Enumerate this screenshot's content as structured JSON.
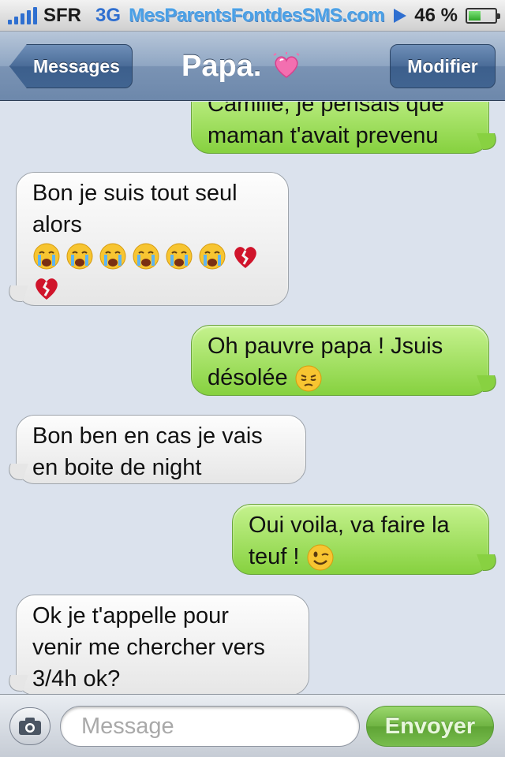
{
  "status_bar": {
    "carrier": "SFR",
    "network": "3G",
    "watermark": "MesParentsFontdesSMS.com",
    "battery": "46 %",
    "battery_level": 0.46,
    "signal_bars": 5
  },
  "nav": {
    "back_label": "Messages",
    "title": "Papa.",
    "edit_label": "Modifier"
  },
  "messages": [
    {
      "direction": "out",
      "lines": [
        "Camille, je pensais que",
        "maman t'avait prevenu"
      ]
    },
    {
      "direction": "in",
      "lines": [
        "Bon je suis tout seul",
        "alors"
      ],
      "emoji": [
        "crying-face",
        "crying-face",
        "crying-face",
        "crying-face",
        "crying-face",
        "crying-face",
        "broken-heart",
        "broken-heart"
      ]
    },
    {
      "direction": "out",
      "lines": [
        "Oh pauvre papa ! Jsuis",
        "désolée"
      ],
      "emoji": [
        "pensive-face"
      ]
    },
    {
      "direction": "in",
      "lines": [
        "Bon ben en cas je vais",
        "en boite de night"
      ]
    },
    {
      "direction": "out",
      "lines": [
        "Oui voila, va faire la",
        "teuf !"
      ],
      "emoji": [
        "winking-face"
      ]
    },
    {
      "direction": "in",
      "lines": [
        "Ok je t'appelle pour",
        "venir me chercher vers",
        "3/4h ok?"
      ]
    }
  ],
  "input": {
    "placeholder": "Message",
    "send_label": "Envoyer"
  },
  "colors": {
    "incoming_bubble": "#ececec",
    "outgoing_bubble": "#9fdf5c",
    "background": "#dbe2ed",
    "nav_bar": "#7a93b4"
  }
}
